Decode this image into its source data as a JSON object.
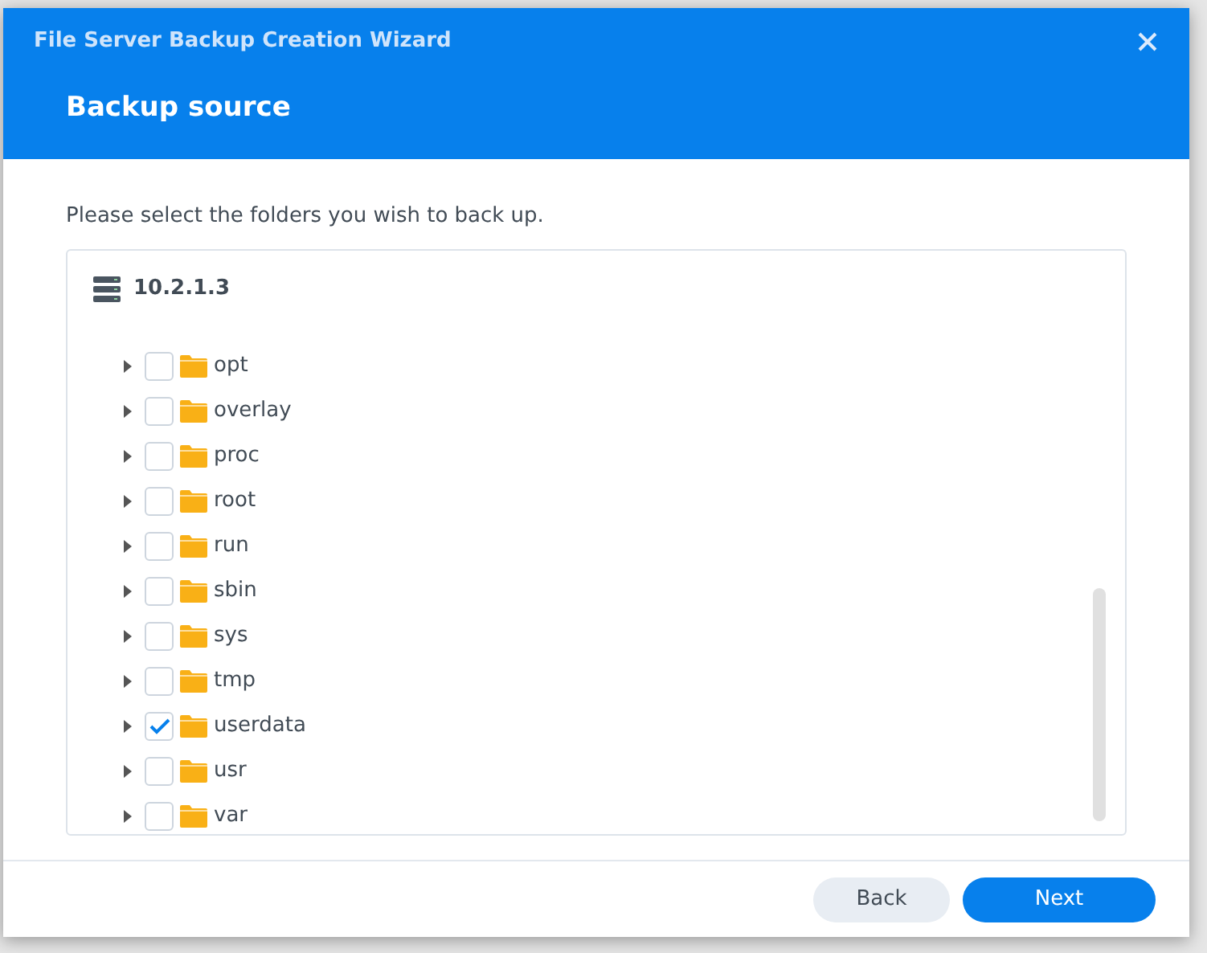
{
  "window": {
    "title": "File Server Backup Creation Wizard"
  },
  "header": {
    "title": "Backup source"
  },
  "instruction": "Please select the folders you wish to back up.",
  "tree": {
    "root": "10.2.1.3",
    "children": [
      {
        "name": "opt",
        "checked": false
      },
      {
        "name": "overlay",
        "checked": false
      },
      {
        "name": "proc",
        "checked": false
      },
      {
        "name": "root",
        "checked": false
      },
      {
        "name": "run",
        "checked": false
      },
      {
        "name": "sbin",
        "checked": false
      },
      {
        "name": "sys",
        "checked": false
      },
      {
        "name": "tmp",
        "checked": false
      },
      {
        "name": "userdata",
        "checked": true
      },
      {
        "name": "usr",
        "checked": false
      },
      {
        "name": "var",
        "checked": false
      }
    ]
  },
  "buttons": [
    {
      "label": "Back",
      "kind": "secondary"
    },
    {
      "label": "Next",
      "kind": "primary"
    }
  ]
}
